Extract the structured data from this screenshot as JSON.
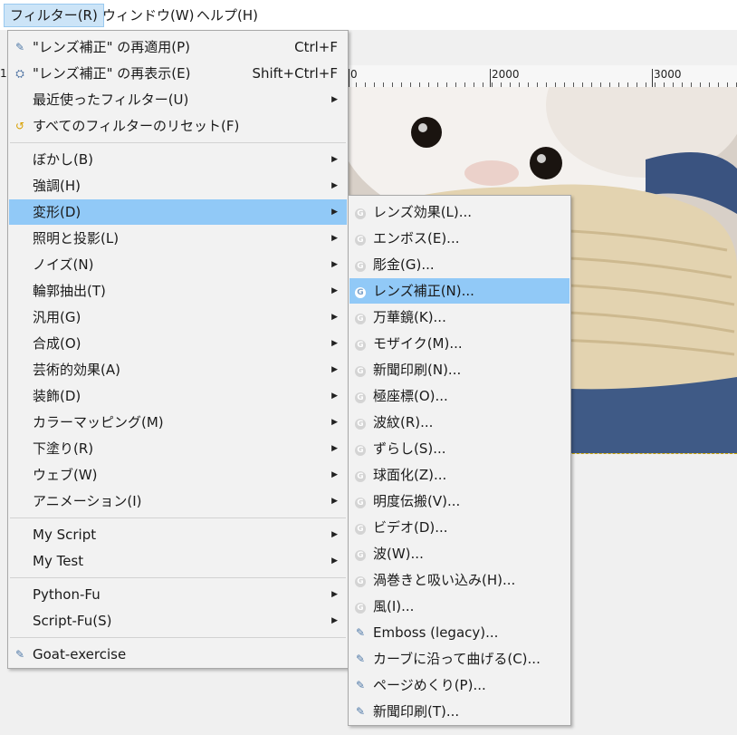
{
  "menubar": {
    "items": [
      {
        "label": "フィルター(R)",
        "active": true
      },
      {
        "label": "ウィンドウ(W)",
        "active": false
      },
      {
        "label": "ヘルプ(H)",
        "active": false
      }
    ]
  },
  "ruler": {
    "left_label": "1",
    "labels": [
      "0",
      "2000",
      "3000"
    ]
  },
  "main_menu": {
    "items": [
      {
        "icon": "python-icon",
        "label": "\"レンズ補正\" の再適用(P)",
        "accel": "Ctrl+F"
      },
      {
        "icon": "reshow-icon",
        "label": "\"レンズ補正\" の再表示(E)",
        "accel": "Shift+Ctrl+F"
      },
      {
        "icon": "",
        "label": "最近使ったフィルター(U)",
        "submenu": true
      },
      {
        "icon": "reset-icon",
        "label": "すべてのフィルターのリセット(F)"
      },
      {
        "sep": true
      },
      {
        "icon": "",
        "label": "ぼかし(B)",
        "submenu": true
      },
      {
        "icon": "",
        "label": "強調(H)",
        "submenu": true
      },
      {
        "icon": "",
        "label": "変形(D)",
        "submenu": true,
        "highlight": true
      },
      {
        "icon": "",
        "label": "照明と投影(L)",
        "submenu": true
      },
      {
        "icon": "",
        "label": "ノイズ(N)",
        "submenu": true
      },
      {
        "icon": "",
        "label": "輪郭抽出(T)",
        "submenu": true
      },
      {
        "icon": "",
        "label": "汎用(G)",
        "submenu": true
      },
      {
        "icon": "",
        "label": "合成(O)",
        "submenu": true
      },
      {
        "icon": "",
        "label": "芸術的効果(A)",
        "submenu": true
      },
      {
        "icon": "",
        "label": "装飾(D)",
        "submenu": true
      },
      {
        "icon": "",
        "label": "カラーマッピング(M)",
        "submenu": true
      },
      {
        "icon": "",
        "label": "下塗り(R)",
        "submenu": true
      },
      {
        "icon": "",
        "label": "ウェブ(W)",
        "submenu": true
      },
      {
        "icon": "",
        "label": "アニメーション(I)",
        "submenu": true
      },
      {
        "sep": true
      },
      {
        "icon": "",
        "label": "My Script",
        "submenu": true
      },
      {
        "icon": "",
        "label": "My Test",
        "submenu": true
      },
      {
        "sep": true
      },
      {
        "icon": "",
        "label": "Python-Fu",
        "submenu": true
      },
      {
        "icon": "",
        "label": "Script-Fu(S)",
        "submenu": true
      },
      {
        "sep": true
      },
      {
        "icon": "python-icon",
        "label": "Goat-exercise"
      }
    ]
  },
  "sub_menu": {
    "items": [
      {
        "icon": "gegl-icon",
        "label": "レンズ効果(L)..."
      },
      {
        "icon": "gegl-icon",
        "label": "エンボス(E)..."
      },
      {
        "icon": "gegl-icon",
        "label": "彫金(G)..."
      },
      {
        "icon": "gegl-icon",
        "label": "レンズ補正(N)...",
        "highlight": true
      },
      {
        "icon": "gegl-icon",
        "label": "万華鏡(K)..."
      },
      {
        "icon": "gegl-icon",
        "label": "モザイク(M)..."
      },
      {
        "icon": "gegl-icon",
        "label": "新聞印刷(N)..."
      },
      {
        "icon": "gegl-icon",
        "label": "極座標(O)..."
      },
      {
        "icon": "gegl-icon",
        "label": "波紋(R)..."
      },
      {
        "icon": "gegl-icon",
        "label": "ずらし(S)..."
      },
      {
        "icon": "gegl-icon",
        "label": "球面化(Z)..."
      },
      {
        "icon": "gegl-icon",
        "label": "明度伝搬(V)..."
      },
      {
        "icon": "gegl-icon",
        "label": "ビデオ(D)..."
      },
      {
        "icon": "gegl-icon",
        "label": "波(W)..."
      },
      {
        "icon": "gegl-icon",
        "label": "渦巻きと吸い込み(H)..."
      },
      {
        "icon": "gegl-icon",
        "label": "風(I)..."
      },
      {
        "icon": "python-icon",
        "label": "Emboss (legacy)..."
      },
      {
        "icon": "python-icon",
        "label": "カーブに沿って曲げる(C)..."
      },
      {
        "icon": "python-icon",
        "label": "ページめくり(P)..."
      },
      {
        "icon": "python-icon",
        "label": "新聞印刷(T)..."
      }
    ]
  }
}
